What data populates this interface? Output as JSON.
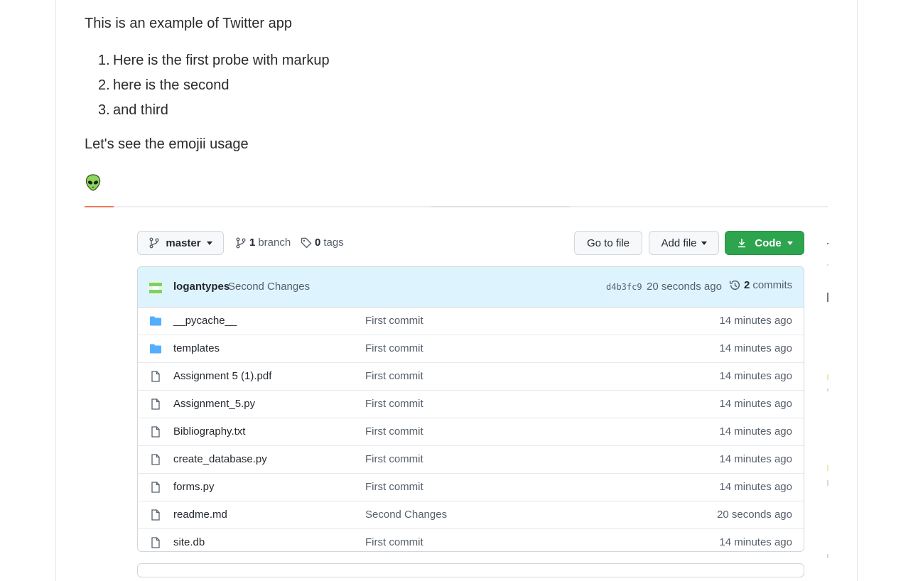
{
  "post": {
    "intro": "This is an example of Twitter app",
    "list": [
      {
        "num": "1.",
        "text": "Here is the first probe with markup"
      },
      {
        "num": "2.",
        "text": "here is the second"
      },
      {
        "num": "3.",
        "text": "and third"
      }
    ],
    "outro": "Let's see the emojii usage",
    "emoji": "alien-icon"
  },
  "repo": {
    "branch_name": "master",
    "branch_count": "1",
    "branch_label": "branch",
    "tag_count": "0",
    "tag_label": "tags",
    "go_to_file": "Go to file",
    "add_file": "Add file",
    "code": "Code",
    "commit": {
      "author": "logantypes",
      "message": "Second Changes",
      "sha": "d4b3fc9",
      "age": "20 seconds ago",
      "commit_count": "2",
      "commit_label": "commits"
    },
    "files": [
      {
        "type": "folder",
        "name": "__pycache__",
        "message": "First commit",
        "age": "14 minutes ago"
      },
      {
        "type": "folder",
        "name": "templates",
        "message": "First commit",
        "age": "14 minutes ago"
      },
      {
        "type": "file",
        "name": "Assignment 5 (1).pdf",
        "message": "First commit",
        "age": "14 minutes ago"
      },
      {
        "type": "file",
        "name": "Assignment_5.py",
        "message": "First commit",
        "age": "14 minutes ago"
      },
      {
        "type": "file",
        "name": "Bibliography.txt",
        "message": "First commit",
        "age": "14 minutes ago"
      },
      {
        "type": "file",
        "name": "create_database.py",
        "message": "First commit",
        "age": "14 minutes ago"
      },
      {
        "type": "file",
        "name": "forms.py",
        "message": "First commit",
        "age": "14 minutes ago"
      },
      {
        "type": "file",
        "name": "readme.md",
        "message": "Second Changes",
        "age": "20 seconds ago"
      },
      {
        "type": "file",
        "name": "site.db",
        "message": "First commit",
        "age": "14 minutes ago"
      }
    ]
  },
  "colors": {
    "accent_divider": "#f07a5a",
    "code_button": "#2da44e",
    "commit_bar": "#ddf4ff",
    "folder_icon": "#54aeff"
  }
}
